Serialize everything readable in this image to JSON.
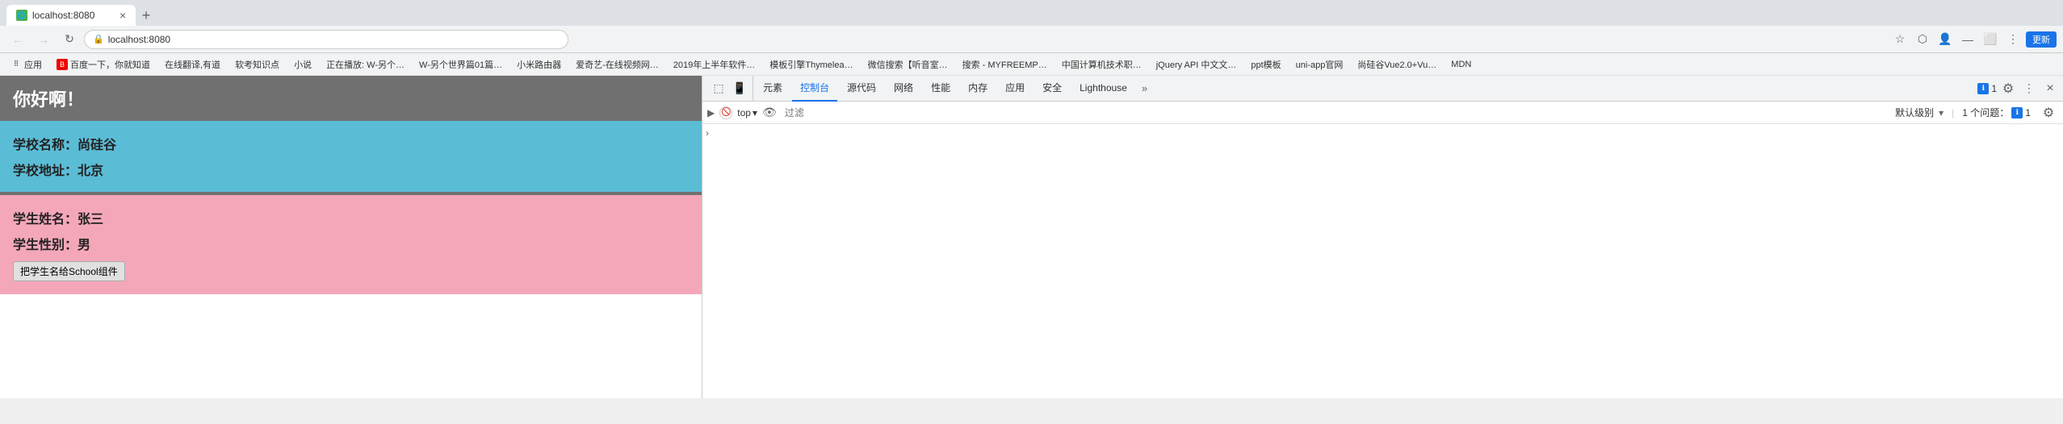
{
  "browser": {
    "address": "localhost:8080",
    "tab_title": "localhost:8080",
    "update_btn": "更新"
  },
  "bookmarks": [
    {
      "label": "应用"
    },
    {
      "label": "百度一下，你就知道"
    },
    {
      "label": "在线翻译,有道"
    },
    {
      "label": "软考知识点"
    },
    {
      "label": "小说"
    },
    {
      "label": "正在播放: W-另个…"
    },
    {
      "label": "W-另个世界篇01篇…"
    },
    {
      "label": "小米路由器"
    },
    {
      "label": "爱奇艺-在线视频网…"
    },
    {
      "label": "2019年上半年软件…"
    },
    {
      "label": "模板引擎Thymelea…"
    },
    {
      "label": "微信搜索【听音室…"
    },
    {
      "label": "搜索 - MYFREEMP…"
    },
    {
      "label": "中国计算机技术职…"
    },
    {
      "label": "jQuery API 中文文…"
    },
    {
      "label": "ppt模板"
    },
    {
      "label": "uni-app官网"
    },
    {
      "label": "尚硅谷Vue2.0+Vu…"
    },
    {
      "label": "MDN"
    }
  ],
  "webpage": {
    "header_text": "你好啊！",
    "school_name_label": "学校名称：",
    "school_name_value": "尚硅谷",
    "school_addr_label": "学校地址：",
    "school_addr_value": "北京",
    "student_name_label": "学生姓名：",
    "student_name_value": "张三",
    "student_gender_label": "学生性别：",
    "student_gender_value": "男",
    "pass_btn_label": "把学生名给School组件"
  },
  "devtools": {
    "tabs": [
      "元素",
      "控制台",
      "源代码",
      "网络",
      "性能",
      "内存",
      "应用",
      "安全",
      "Lighthouse"
    ],
    "active_tab": "控制台",
    "more_tabs": "»",
    "top_selector": "top",
    "filter_placeholder": "过滤",
    "level_selector": "默认级别",
    "issue_count": "1 个问题：",
    "issue_badge": "1",
    "console_arrow": "▶"
  }
}
